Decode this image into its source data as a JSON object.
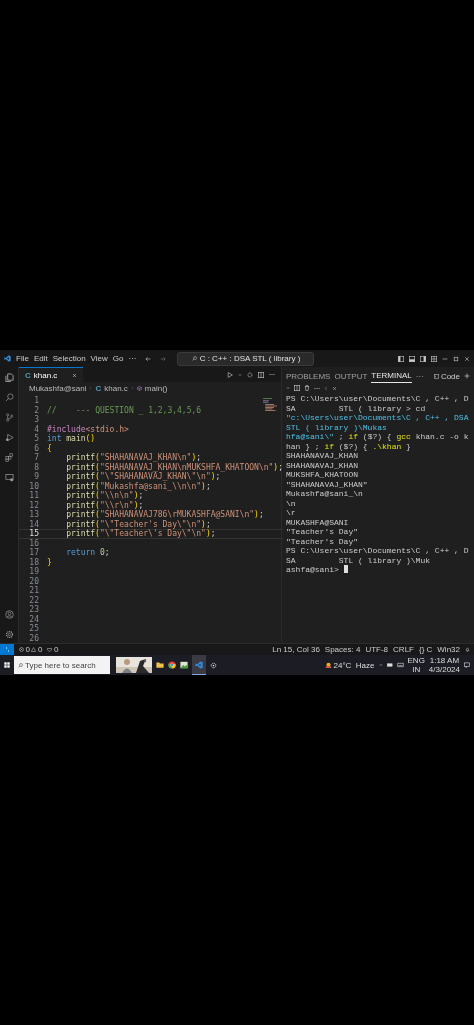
{
  "title_bar": {
    "menu": [
      "File",
      "Edit",
      "Selection",
      "View",
      "Go",
      "···"
    ],
    "command_center": "C : C++ : DSA STL ( library )"
  },
  "editor": {
    "tabs": [
      {
        "label": "khan.c",
        "file_icon": "C",
        "selected": true
      }
    ],
    "breadcrumb": [
      "Mukashfa@sani",
      "khan.c",
      "main()"
    ],
    "file_icon": "C",
    "lines": [
      {
        "number": "1",
        "current": false
      },
      {
        "number": "2",
        "indented": false,
        "current": false,
        "tokens": [
          {
            "kind": "comment",
            "text": "//    --- QUESTION _ 1,2,3,4,5,6"
          }
        ]
      },
      {
        "number": "3",
        "current": false
      },
      {
        "number": "4",
        "indented": false,
        "current": false,
        "tokens": [
          {
            "kind": "directive",
            "text": "#include"
          },
          {
            "kind": "string",
            "text": "<stdio.h>"
          }
        ]
      },
      {
        "number": "5",
        "indented": false,
        "current": false,
        "tokens": [
          {
            "kind": "keyword",
            "text": "int "
          },
          {
            "kind": "function",
            "text": "main"
          },
          {
            "kind": "punct",
            "text": "()"
          }
        ]
      },
      {
        "number": "6",
        "indented": false,
        "current": false,
        "tokens": [
          {
            "kind": "punct",
            "text": "{"
          }
        ]
      },
      {
        "number": "7",
        "indented": true,
        "current": false,
        "tokens": [
          {
            "kind": "function",
            "text": "printf"
          },
          {
            "kind": "punct",
            "text": "("
          },
          {
            "kind": "string",
            "text": "\"SHAHANAVAJ_KHAN\\n\""
          },
          {
            "kind": "punct",
            "text": ")"
          },
          {
            "kind": "plain",
            "text": ";"
          }
        ]
      },
      {
        "number": "8",
        "indented": true,
        "current": false,
        "tokens": [
          {
            "kind": "function",
            "text": "printf"
          },
          {
            "kind": "punct",
            "text": "("
          },
          {
            "kind": "string",
            "text": "\"SHAHANAVAJ_KHAN\\nMUKSHFA_KHATOON\\n\""
          },
          {
            "kind": "punct",
            "text": ")"
          },
          {
            "kind": "plain",
            "text": ";"
          }
        ]
      },
      {
        "number": "9",
        "indented": true,
        "current": false,
        "tokens": [
          {
            "kind": "function",
            "text": "printf"
          },
          {
            "kind": "punct",
            "text": "("
          },
          {
            "kind": "string",
            "text": "\"\\\"SHAHANAVAJ_KHAN\\\"\\n\""
          },
          {
            "kind": "punct",
            "text": ")"
          },
          {
            "kind": "plain",
            "text": ";"
          }
        ]
      },
      {
        "number": "10",
        "indented": true,
        "current": false,
        "tokens": [
          {
            "kind": "function",
            "text": "printf"
          },
          {
            "kind": "punct",
            "text": "("
          },
          {
            "kind": "string",
            "text": "\"Mukashfa@sani_\\\\n\\n\""
          },
          {
            "kind": "punct",
            "text": ")"
          },
          {
            "kind": "plain",
            "text": ";"
          }
        ]
      },
      {
        "number": "11",
        "indented": true,
        "current": false,
        "tokens": [
          {
            "kind": "function",
            "text": "printf"
          },
          {
            "kind": "punct",
            "text": "("
          },
          {
            "kind": "string",
            "text": "\"\\\\n\\n\""
          },
          {
            "kind": "punct",
            "text": ")"
          },
          {
            "kind": "plain",
            "text": ";"
          }
        ]
      },
      {
        "number": "12",
        "indented": true,
        "current": false,
        "tokens": [
          {
            "kind": "function",
            "text": "printf"
          },
          {
            "kind": "punct",
            "text": "("
          },
          {
            "kind": "string",
            "text": "\"\\\\r\\n\""
          },
          {
            "kind": "punct",
            "text": ")"
          },
          {
            "kind": "plain",
            "text": ";"
          }
        ]
      },
      {
        "number": "13",
        "indented": true,
        "current": false,
        "tokens": [
          {
            "kind": "function",
            "text": "printf"
          },
          {
            "kind": "punct",
            "text": "("
          },
          {
            "kind": "string",
            "text": "\"SHAHANAVAJ786\\rMUKASHFA@SANI\\n\""
          },
          {
            "kind": "punct",
            "text": ")"
          },
          {
            "kind": "plain",
            "text": ";"
          }
        ]
      },
      {
        "number": "14",
        "indented": true,
        "current": false,
        "tokens": [
          {
            "kind": "function",
            "text": "printf"
          },
          {
            "kind": "punct",
            "text": "("
          },
          {
            "kind": "string",
            "text": "\"\\\"Teacher's Day\\\"\\n\""
          },
          {
            "kind": "punct",
            "text": ")"
          },
          {
            "kind": "plain",
            "text": ";"
          }
        ]
      },
      {
        "number": "15",
        "indented": true,
        "current": true,
        "tokens": [
          {
            "kind": "function",
            "text": "printf"
          },
          {
            "kind": "punct",
            "text": "("
          },
          {
            "kind": "string",
            "text": "\"\\\"Teacher\\'s Day\\\"\\n\""
          },
          {
            "kind": "punct",
            "text": ")"
          },
          {
            "kind": "plain",
            "text": ";"
          }
        ]
      },
      {
        "number": "16",
        "current": false
      },
      {
        "number": "17",
        "indented": true,
        "current": false,
        "tokens": [
          {
            "kind": "keyword",
            "text": "return "
          },
          {
            "kind": "number",
            "text": "0"
          },
          {
            "kind": "plain",
            "text": ";"
          }
        ]
      },
      {
        "number": "18",
        "indented": false,
        "current": false,
        "tokens": [
          {
            "kind": "punct",
            "text": "}"
          }
        ]
      },
      {
        "number": "19",
        "current": false
      },
      {
        "number": "20",
        "current": false
      },
      {
        "number": "21",
        "current": false
      },
      {
        "number": "22",
        "current": false
      },
      {
        "number": "23",
        "current": false
      },
      {
        "number": "24",
        "current": false
      },
      {
        "number": "25",
        "current": false
      },
      {
        "number": "26",
        "current": false
      }
    ]
  },
  "panel": {
    "tabs": [
      {
        "label": "PROBLEMS",
        "selected": false
      },
      {
        "label": "OUTPUT",
        "selected": false
      },
      {
        "label": "TERMINAL",
        "selected": true
      }
    ],
    "more": "···",
    "terminal_name": "Code",
    "rows": [
      {
        "cursor": false,
        "tokens": [
          {
            "kind": "plain",
            "text": "PS C:\\Users\\user\\Documents\\C , C++ , DSA         STL ( library > cd"
          }
        ]
      },
      {
        "cursor": false,
        "tokens": [
          {
            "kind": "string",
            "text": "\"c:\\Users\\user\\Documents\\C , C++ , DSA         STL ( library )\\Mukas"
          }
        ]
      },
      {
        "cursor": false,
        "tokens": [
          {
            "kind": "string",
            "text": "hfa@sani\\\""
          },
          {
            "kind": "plain",
            "text": " ; "
          },
          {
            "kind": "command",
            "text": "if"
          },
          {
            "kind": "plain",
            "text": " ($?) { "
          },
          {
            "kind": "command",
            "text": "gcc"
          },
          {
            "kind": "plain",
            "text": " khan.c -o khan } ; "
          },
          {
            "kind": "command",
            "text": "if"
          },
          {
            "kind": "plain",
            "text": " ($?) { "
          },
          {
            "kind": "command",
            "text": ".\\khan"
          },
          {
            "kind": "plain",
            "text": " }"
          }
        ]
      },
      {
        "cursor": false,
        "tokens": [
          {
            "kind": "plain",
            "text": "SHAHANAVAJ_KHAN"
          }
        ]
      },
      {
        "cursor": false,
        "tokens": [
          {
            "kind": "plain",
            "text": "SHAHANAVAJ_KHAN"
          }
        ]
      },
      {
        "cursor": false,
        "tokens": [
          {
            "kind": "plain",
            "text": "MUKSHFA_KHATOON"
          }
        ]
      },
      {
        "cursor": false,
        "tokens": [
          {
            "kind": "plain",
            "text": "\"SHAHANAVAJ_KHAN\""
          }
        ]
      },
      {
        "cursor": false,
        "tokens": [
          {
            "kind": "plain",
            "text": "Mukashfa@sani_\\n"
          }
        ]
      },
      {
        "cursor": false,
        "tokens": [
          {
            "kind": "plain",
            "text": "\\n"
          }
        ]
      },
      {
        "cursor": false,
        "tokens": [
          {
            "kind": "plain",
            "text": "\\r"
          }
        ]
      },
      {
        "cursor": false,
        "tokens": [
          {
            "kind": "plain",
            "text": "MUKASHFA@SANI"
          }
        ]
      },
      {
        "cursor": false,
        "tokens": [
          {
            "kind": "plain",
            "text": "\"Teacher's Day\""
          }
        ]
      },
      {
        "cursor": false,
        "tokens": [
          {
            "kind": "plain",
            "text": "\"Teacher's Day\""
          }
        ]
      },
      {
        "cursor": false,
        "tokens": [
          {
            "kind": "plain",
            "text": "PS C:\\Users\\user\\Documents\\C , C++ , DSA         STL ( library )\\Muk"
          }
        ]
      },
      {
        "cursor": true,
        "tokens": [
          {
            "kind": "plain",
            "text": "ashfa@sani> "
          }
        ]
      }
    ]
  },
  "status_bar": {
    "errors": "0",
    "warnings": "0",
    "ports": "0",
    "right": [
      "Ln 15, Col 36",
      "Spaces: 4",
      "UTF-8",
      "CRLF",
      "{} C",
      "Win32"
    ]
  },
  "taskbar": {
    "search_placeholder": "Type here to search",
    "weather": "24°C  Haze",
    "language": [
      "ENG",
      "IN"
    ],
    "time": "1:18 AM",
    "date": "4/3/2024"
  }
}
